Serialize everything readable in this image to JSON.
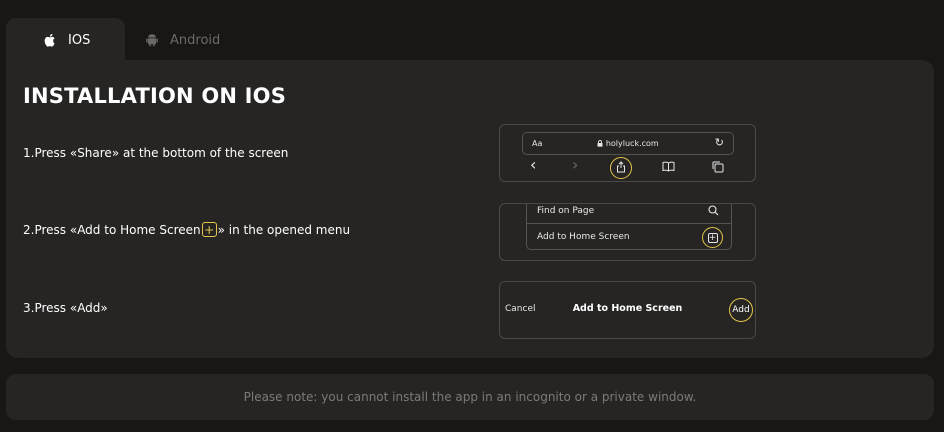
{
  "tabs": [
    {
      "label": "IOS",
      "icon": "apple-icon",
      "active": true
    },
    {
      "label": "Android",
      "icon": "android-icon",
      "active": false
    }
  ],
  "panel": {
    "title": "INSTALLATION ON IOS",
    "steps": [
      {
        "text": "1.Press «Share» at the bottom of the screen"
      },
      {
        "text_before": "2.Press «Add to Home Screen",
        "plus": "+",
        "text_after": "» in the opened menu"
      },
      {
        "text": "3.Press «Add»"
      }
    ]
  },
  "mock_browser": {
    "aa": "Aa",
    "url": "holyluck.com",
    "back": "‹",
    "forward": "›",
    "reload": "↻"
  },
  "mock_menu": {
    "find_label": "Find on Page",
    "add_label": "Add to Home Screen",
    "add_symbol": "+"
  },
  "mock_dialog": {
    "cancel": "Cancel",
    "title": "Add to Home Screen",
    "add": "Add"
  },
  "note": "Please note: you cannot install the app in an incognito or a private window.",
  "colors": {
    "background": "#181716",
    "panel": "#262523",
    "accent": "#e3c54a",
    "muted": "#7b7a77"
  }
}
